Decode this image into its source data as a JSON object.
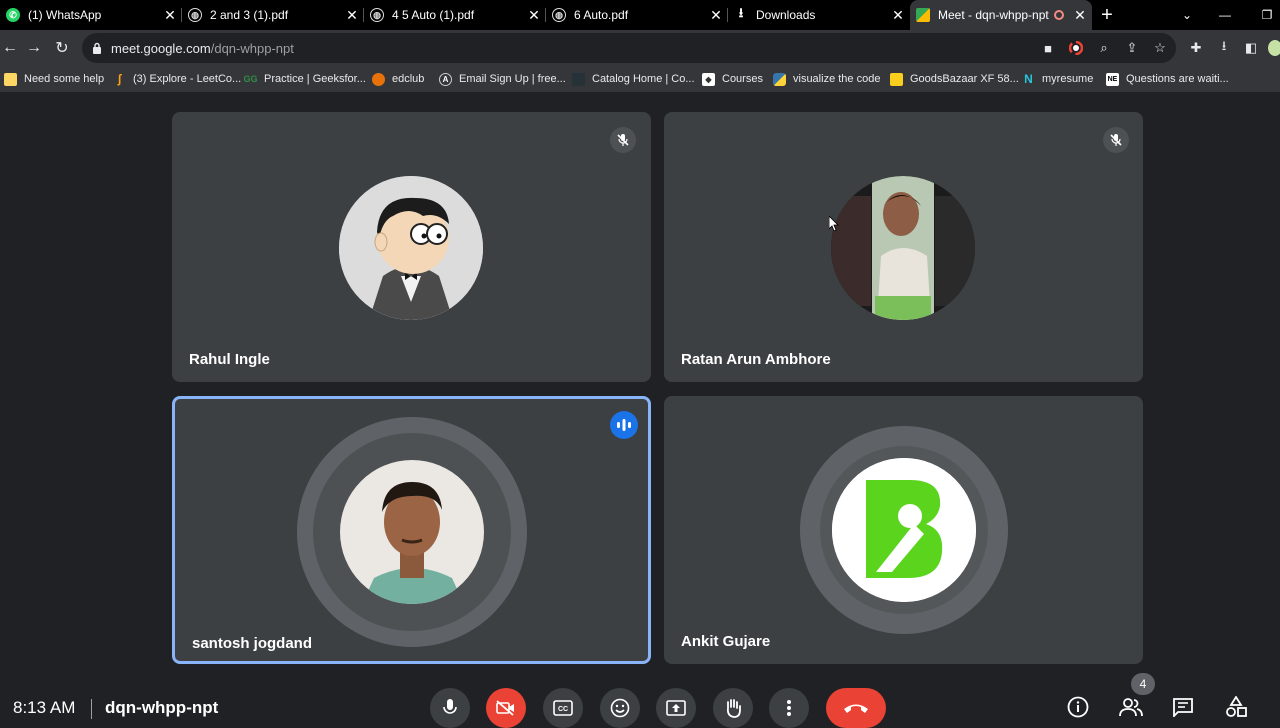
{
  "browser": {
    "tabs": [
      {
        "title": "(1) WhatsApp",
        "icon": "whatsapp-icon",
        "active": false
      },
      {
        "title": "2 and 3 (1).pdf",
        "icon": "globe-icon",
        "active": false
      },
      {
        "title": "4 5 Auto (1).pdf",
        "icon": "globe-icon",
        "active": false
      },
      {
        "title": "6 Auto.pdf",
        "icon": "globe-icon",
        "active": false
      },
      {
        "title": "Downloads",
        "icon": "download-icon",
        "active": false
      },
      {
        "title": "Meet - dqn-whpp-npt",
        "icon": "meet-icon",
        "active": true
      }
    ],
    "url_host": "meet.google.com",
    "url_path": "/dqn-whpp-npt",
    "bookmarks": [
      {
        "label": "Need some help",
        "icon": "folder-icon"
      },
      {
        "label": "(3) Explore - LeetCo...",
        "icon": "leetcode-icon"
      },
      {
        "label": "Practice | Geeksfor...",
        "icon": "geeksforgeeks-icon"
      },
      {
        "label": "edclub",
        "icon": "edclub-icon"
      },
      {
        "label": "Email Sign Up | free...",
        "icon": "anchor-icon"
      },
      {
        "label": "Catalog Home | Co...",
        "icon": "catalog-icon"
      },
      {
        "label": "Courses",
        "icon": "courses-icon"
      },
      {
        "label": "visualize the code",
        "icon": "python-icon"
      },
      {
        "label": "GoodsBazaar XF 58...",
        "icon": "goodsbazaar-icon"
      },
      {
        "label": "myresume",
        "icon": "myresume-icon"
      },
      {
        "label": "Questions are waiti...",
        "icon": "questions-icon"
      }
    ]
  },
  "meet": {
    "participants": [
      {
        "name": "Rahul Ingle",
        "muted": true,
        "speaking": false
      },
      {
        "name": "Ratan Arun Ambhore",
        "muted": true,
        "speaking": false
      },
      {
        "name": "santosh jogdand",
        "muted": false,
        "speaking": true
      },
      {
        "name": "Ankit Gujare",
        "muted": false,
        "speaking": false
      }
    ],
    "time": "8:13 AM",
    "meeting_code": "dqn-whpp-npt",
    "participant_count": "4"
  },
  "colors": {
    "background": "#202124",
    "tile": "#3c4043",
    "speaking_border": "#8ab4f8",
    "end_call": "#ea4335",
    "logo_green": "#5ad41c"
  }
}
